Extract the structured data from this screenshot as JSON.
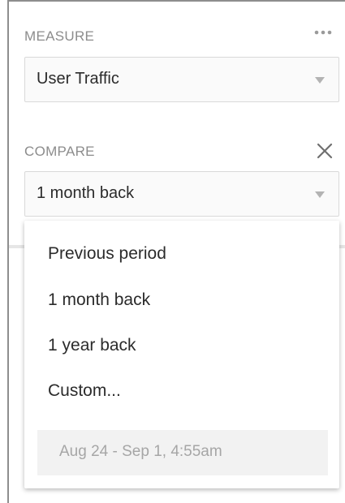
{
  "measure": {
    "label": "MEASURE",
    "selected": "User Traffic",
    "more_icon": "more-horizontal-icon"
  },
  "compare": {
    "label": "COMPARE",
    "selected": "1 month back",
    "close_icon": "close-icon"
  },
  "dropdown": {
    "options": [
      "Previous period",
      "1 month back",
      "1 year back",
      "Custom..."
    ],
    "custom_range": "Aug 24 - Sep 1, 4:55am"
  }
}
